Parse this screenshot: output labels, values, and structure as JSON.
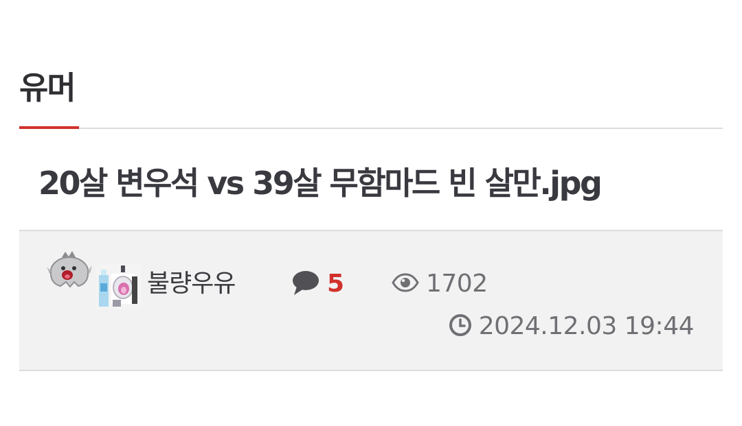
{
  "board": {
    "title": "유머",
    "accent_color": "#d1312c"
  },
  "post": {
    "title": "20살 변우석 vs 39살 무함마드 빈 살만.jpg",
    "author": "불량우유",
    "author_icons": [
      "ghost-level-icon",
      "pixel-avatar-icon"
    ],
    "comment_count": "5",
    "view_count": "1702",
    "date": "2024.12.03 19:44"
  },
  "icons": {
    "comment": "speech-bubble-icon",
    "views": "eye-icon",
    "date": "clock-icon"
  }
}
